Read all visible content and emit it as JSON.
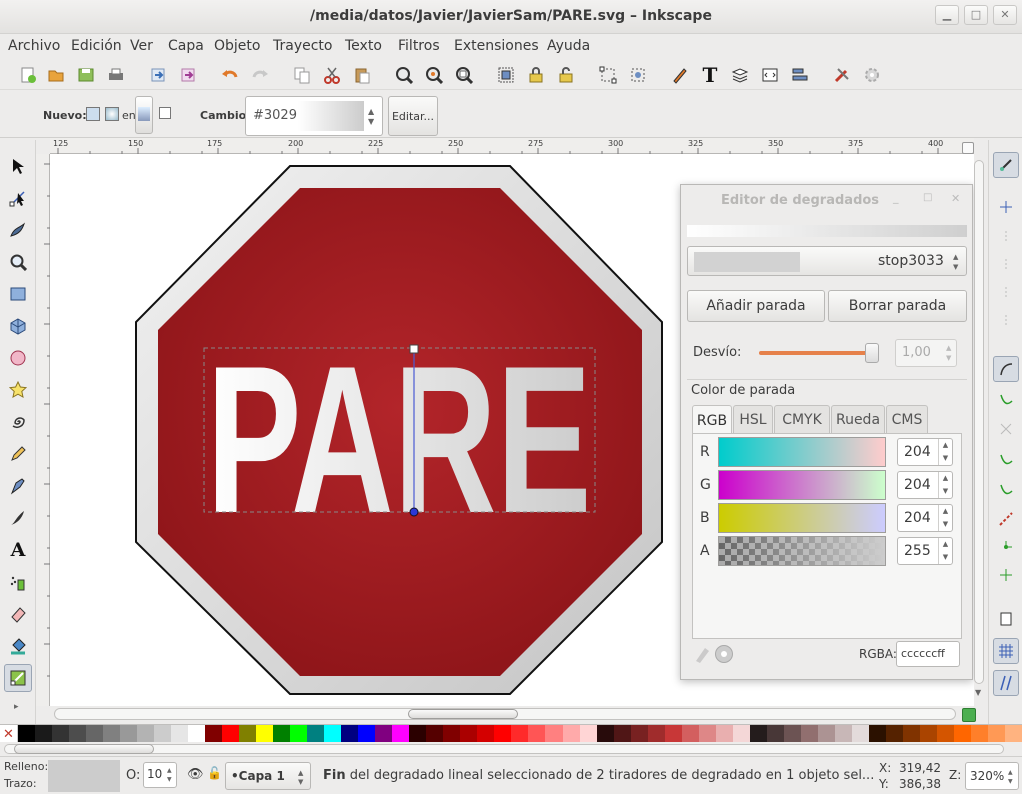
{
  "window": {
    "title": "/media/datos/Javier/JavierSam/PARE.svg – Inkscape"
  },
  "menu": [
    "Archivo",
    "Edición",
    "Ver",
    "Capa",
    "Objeto",
    "Trayecto",
    "Texto",
    "Filtros",
    "Extensiones",
    "Ayuda"
  ],
  "controls": {
    "nuevo_label": "Nuevo:",
    "en_label": "en",
    "cambio_label": "Cambio:",
    "gradient_name": "#3029",
    "edit_button": "Editar..."
  },
  "ruler": {
    "h_ticks": [
      "125",
      "150",
      "175",
      "200",
      "225",
      "250",
      "275",
      "300",
      "325",
      "350",
      "375",
      "400"
    ]
  },
  "canvas": {
    "sign_text": "PARE",
    "colors": {
      "sign_red": "#a81e22",
      "sign_border": "#1a1a1a",
      "text_gradient": "#e6e6e6"
    }
  },
  "gradient_editor": {
    "title": "Editor de degradados",
    "stop_name": "stop3033",
    "add_stop": "Añadir parada",
    "delete_stop": "Borrar parada",
    "offset_label": "Desvío:",
    "offset_value": "1,00",
    "offset_fraction": 1.0,
    "stop_color_label": "Color de parada",
    "tabs": [
      "RGB",
      "HSL",
      "CMYK",
      "Rueda",
      "CMS"
    ],
    "active_tab": "RGB",
    "channels": [
      {
        "name": "R",
        "value": "204"
      },
      {
        "name": "G",
        "value": "204"
      },
      {
        "name": "B",
        "value": "204"
      },
      {
        "name": "A",
        "value": "255"
      }
    ],
    "rgba_label": "RGBA:",
    "rgba_value": "ccccccff"
  },
  "status": {
    "fill_label": "Relleno:",
    "stroke_label": "Trazo:",
    "opacity_label": "O:",
    "opacity_value": "10",
    "layer": "•Capa 1",
    "message_bold": "Fin",
    "message": " del degradado lineal seleccionado de 2 tiradores de degradado en 1 objeto sel...",
    "x_label": "X:",
    "x_value": "319,42",
    "y_label": "Y:",
    "y_value": "386,38",
    "zoom_label": "Z:",
    "zoom_value": "320%"
  },
  "palette": [
    "#000000",
    "#1a1a1a",
    "#333333",
    "#4d4d4d",
    "#666666",
    "#808080",
    "#999999",
    "#b3b3b3",
    "#cccccc",
    "#e6e6e6",
    "#ffffff",
    "#800000",
    "#ff0000",
    "#808000",
    "#ffff00",
    "#008000",
    "#00ff00",
    "#008080",
    "#00ffff",
    "#000080",
    "#0000ff",
    "#800080",
    "#ff00ff",
    "#2b0000",
    "#550000",
    "#800000",
    "#aa0000",
    "#d40000",
    "#ff0000",
    "#ff2a2a",
    "#ff5555",
    "#ff8080",
    "#ffaaaa",
    "#ffd5d5",
    "#280b0b",
    "#501616",
    "#782121",
    "#a02c2c",
    "#c83737",
    "#d35f5f",
    "#de8787",
    "#e9afaf",
    "#f4d7d7",
    "#241c1c",
    "#483737",
    "#6c5353",
    "#916f6f",
    "#ac9393",
    "#c8b7b7",
    "#e3dbdb",
    "#2b1100",
    "#552200",
    "#803300",
    "#aa4400",
    "#d45500",
    "#ff6600",
    "#ff7f2a",
    "#ff9955",
    "#ffb380"
  ]
}
